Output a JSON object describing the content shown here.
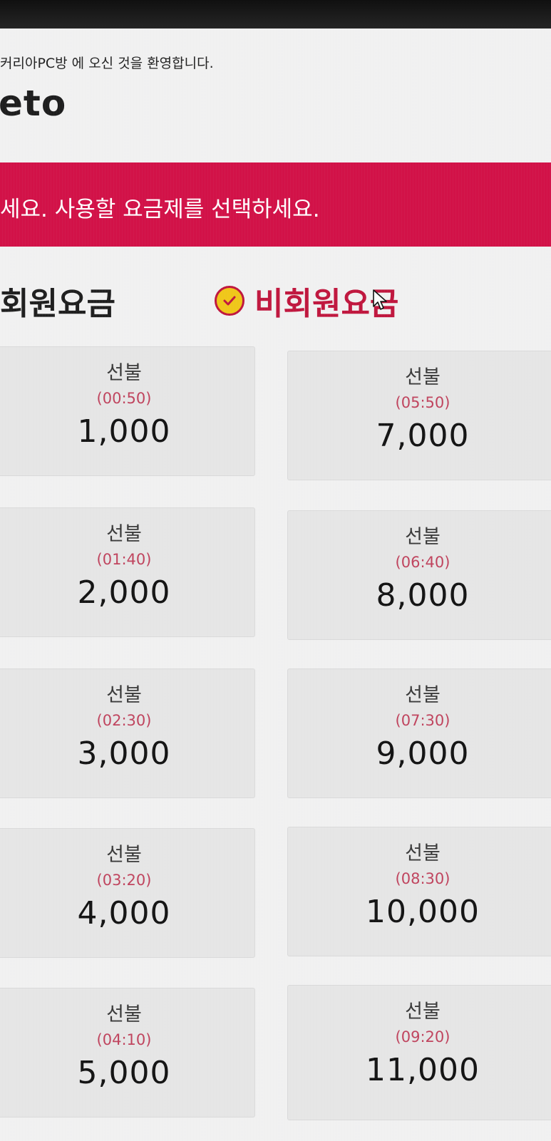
{
  "header": {
    "welcome_text": "커리아PC방 에 오신 것을 환영합니다.",
    "logo_text": "eto"
  },
  "banner": {
    "message": "세요. 사용할 요금제를 선택하세요."
  },
  "tabs": [
    {
      "label": "회원요금",
      "selected": false
    },
    {
      "label": "비회원요금",
      "selected": true
    }
  ],
  "plans": [
    {
      "label": "선불",
      "time": "(00:50)",
      "price": "1,000"
    },
    {
      "label": "선불",
      "time": "(01:40)",
      "price": "2,000"
    },
    {
      "label": "선불",
      "time": "(02:30)",
      "price": "3,000"
    },
    {
      "label": "선불",
      "time": "(03:20)",
      "price": "4,000"
    },
    {
      "label": "선불",
      "time": "(04:10)",
      "price": "5,000"
    },
    {
      "label": "선불",
      "time": "(05:50)",
      "price": "7,000"
    },
    {
      "label": "선불",
      "time": "(06:40)",
      "price": "8,000"
    },
    {
      "label": "선불",
      "time": "(07:30)",
      "price": "9,000"
    },
    {
      "label": "선불",
      "time": "(08:30)",
      "price": "10,000"
    },
    {
      "label": "선불",
      "time": "(09:20)",
      "price": "11,000"
    }
  ],
  "colors": {
    "accent": "#d21248",
    "selected_tab": "#c0173e",
    "time_text": "#c0445e",
    "check_fill": "#f0c71a"
  },
  "icons": {
    "selected_tab_icon": "check-circle-icon",
    "pointer": "mouse-cursor-icon"
  }
}
